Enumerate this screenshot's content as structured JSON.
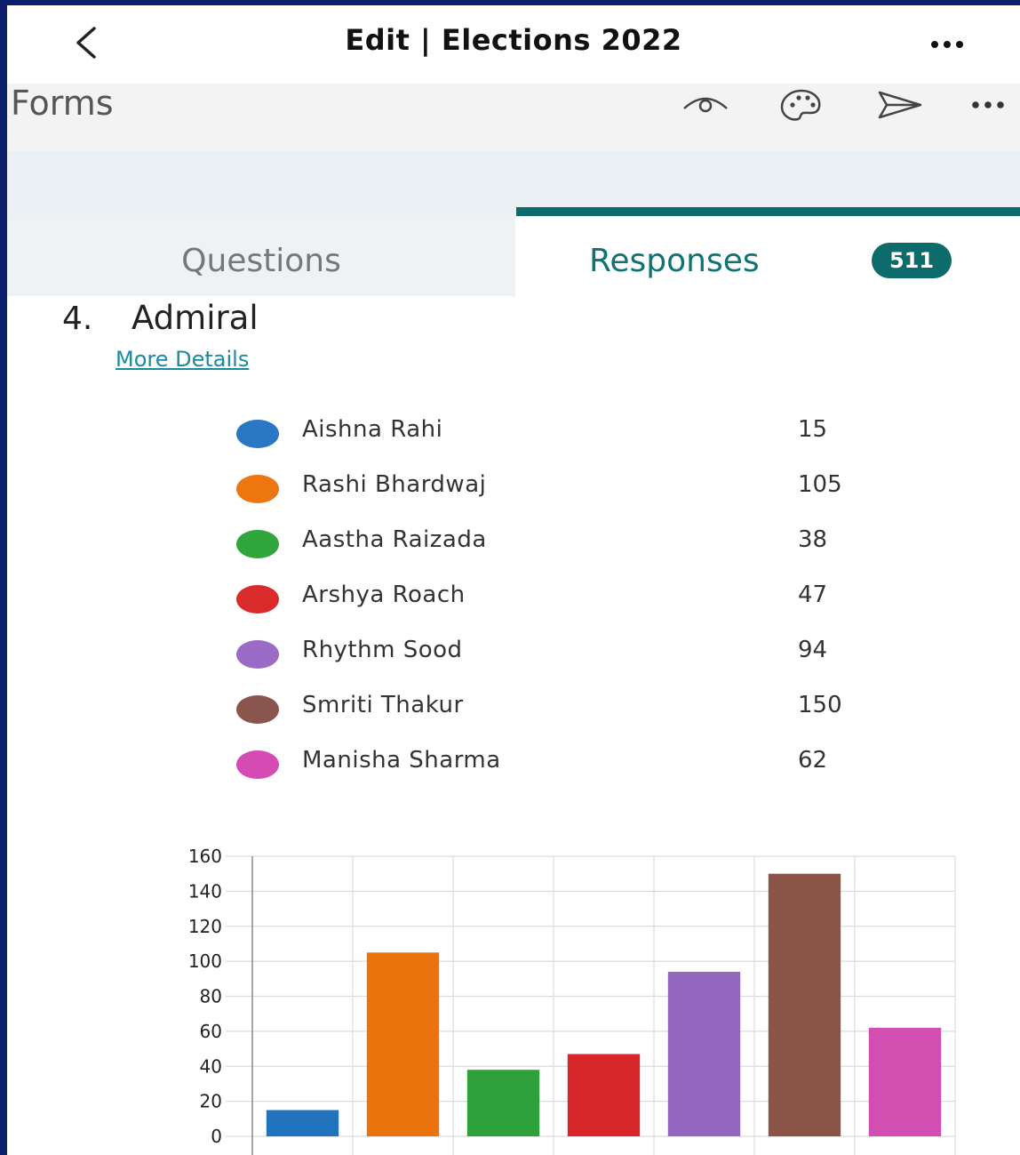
{
  "header": {
    "title": "Edit | Elections 2022",
    "back_icon": "chevron-left-icon",
    "more_icon": "more-horizontal-icon"
  },
  "toolbar": {
    "app_name": "Forms",
    "icons": [
      "eye-icon",
      "palette-icon",
      "send-icon",
      "more-horizontal-icon"
    ]
  },
  "tabs": {
    "questions_label": "Questions",
    "responses_label": "Responses",
    "responses_count": "511",
    "active": "Responses"
  },
  "question": {
    "number": "4.",
    "title": "Admiral",
    "more_details_label": "More Details"
  },
  "legend": [
    {
      "name": "Aishna Rahi",
      "value": "15",
      "color": "#2a78c4"
    },
    {
      "name": "Rashi Bhardwaj",
      "value": "105",
      "color": "#ee7610"
    },
    {
      "name": "Aastha Raizada",
      "value": "38",
      "color": "#30a63c"
    },
    {
      "name": "Arshya Roach",
      "value": "47",
      "color": "#d92b2b"
    },
    {
      "name": "Rhythm Sood",
      "value": "94",
      "color": "#9a6cc6"
    },
    {
      "name": "Smriti Thakur",
      "value": "150",
      "color": "#8a554c"
    },
    {
      "name": "Manisha Sharma",
      "value": "62",
      "color": "#d64ab4"
    }
  ],
  "chart_data": {
    "type": "bar",
    "categories": [
      "Aishna Rahi",
      "Rashi Bhardwaj",
      "Aastha Raizada",
      "Arshya Roach",
      "Rhythm Sood",
      "Smriti Thakur",
      "Manisha Sharma"
    ],
    "values": [
      15,
      105,
      38,
      47,
      94,
      150,
      62
    ],
    "colors": [
      "#2173be",
      "#ea730d",
      "#2ea13b",
      "#d7272b",
      "#9367c0",
      "#8b5449",
      "#d24eb1"
    ],
    "ylim": [
      0,
      160
    ],
    "yticks": [
      "0",
      "20",
      "40",
      "60",
      "80",
      "100",
      "120",
      "140",
      "160"
    ],
    "grid": true
  }
}
